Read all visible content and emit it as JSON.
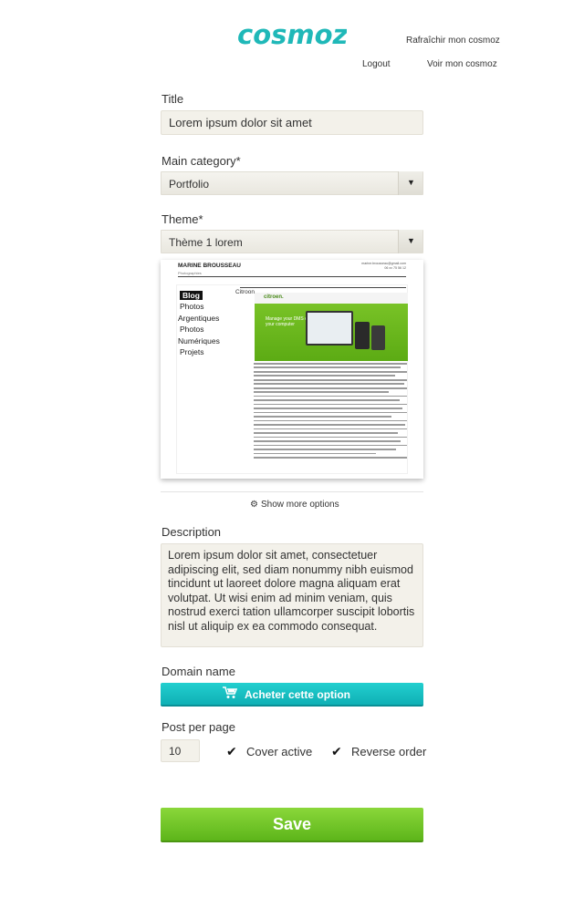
{
  "header": {
    "logo_text": "cosmoz",
    "brand_color": "#1fb8b8",
    "refresh_link": "Rafraîchir mon cosmoz",
    "logout_link": "Logout",
    "view_link": "Voir mon cosmoz"
  },
  "form": {
    "title": {
      "label": "Title",
      "value": "Lorem ipsum dolor sit amet"
    },
    "main_category": {
      "label": "Main category*",
      "selected": "Portfolio",
      "arrow_icon": "triangle-down-icon"
    },
    "theme": {
      "label": "Theme*",
      "selected": "Thème 1 lorem",
      "arrow_icon": "triangle-down-icon"
    },
    "theme_preview": {
      "name": "MARINE BROUSSEAU",
      "subtitle": "Photographies",
      "contact_line1": "marine.brousseau@gmail.com",
      "contact_line2": "06 xx 75 56 12",
      "nav": [
        "Blog",
        "Photos",
        "Argentiques",
        "Photos",
        "Numériques",
        "Projets"
      ],
      "post_title": "Citroon",
      "screenshot_brand": "citroen.",
      "screenshot_tagline": "Manage your DMS on your computer"
    },
    "more_options": {
      "label": "Show more options",
      "icon": "gear-icon"
    },
    "description": {
      "label": "Description",
      "value": "Lorem ipsum dolor sit amet, consectetuer adipiscing elit, sed diam nonummy nibh euismod tincidunt ut laoreet dolore magna aliquam erat volutpat. Ut wisi enim ad minim veniam, quis nostrud exerci tation ullamcorper suscipit lobortis nisl ut aliquip ex ea commodo consequat."
    },
    "domain_name": {
      "label": "Domain name",
      "button_label": "Acheter cette option",
      "button_icon": "cart-icon",
      "button_color": "#1cc3c6"
    },
    "post_per_page": {
      "label": "Post per page",
      "value": "10"
    },
    "cover_active": {
      "label": "Cover active",
      "checked": true
    },
    "reverse_order": {
      "label": "Reverse order",
      "checked": true
    },
    "save": {
      "label": "Save",
      "color": "#72c62a"
    }
  }
}
